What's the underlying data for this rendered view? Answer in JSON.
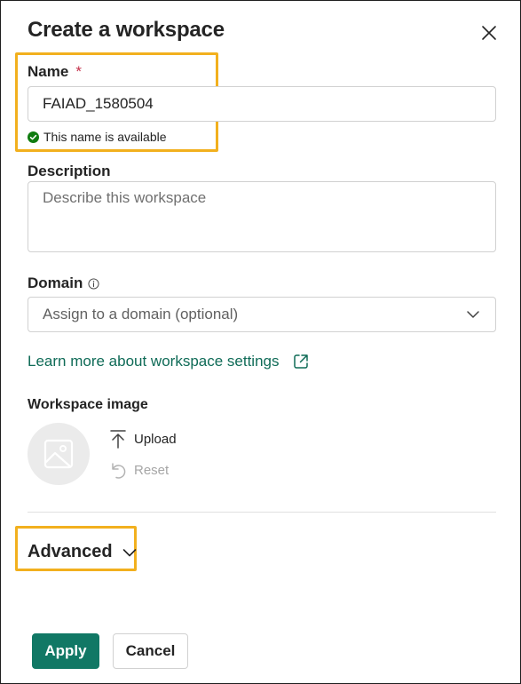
{
  "dialog": {
    "title": "Create a workspace"
  },
  "name_field": {
    "label": "Name",
    "required_marker": "*",
    "value": "FAIAD_1580504",
    "availability": "This name is available"
  },
  "description_field": {
    "label": "Description",
    "placeholder": "Describe this workspace"
  },
  "domain_field": {
    "label": "Domain",
    "placeholder": "Assign to a domain (optional)"
  },
  "learn_more": {
    "text": "Learn more about workspace settings"
  },
  "workspace_image": {
    "label": "Workspace image",
    "upload_label": "Upload",
    "reset_label": "Reset"
  },
  "advanced": {
    "label": "Advanced"
  },
  "actions": {
    "apply_label": "Apply",
    "cancel_label": "Cancel"
  },
  "icons": {
    "close": "close-icon",
    "check": "check-circle-icon",
    "info": "info-icon",
    "chevron": "chevron-down-icon",
    "external": "external-link-icon",
    "image": "image-placeholder-icon",
    "upload": "upload-icon",
    "reset": "undo-icon"
  },
  "colors": {
    "accent": "#117865",
    "link": "#0f6b57",
    "highlight": "#f2b01e",
    "required": "#c4314b",
    "success": "#107c10"
  }
}
